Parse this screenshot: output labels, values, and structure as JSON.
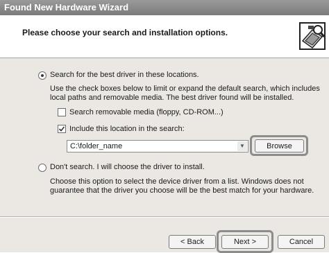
{
  "window": {
    "title": "Found New Hardware Wizard"
  },
  "header": {
    "title": "Please choose your search and installation options."
  },
  "options": {
    "search": {
      "label": "Search for the best driver in these locations.",
      "selected": true,
      "description": "Use the check boxes below to limit or expand the default search, which includes local paths and removable media. The best driver found will be installed.",
      "removable_media_label": "Search removable media (floppy, CD-ROM...)",
      "removable_media_checked": false,
      "include_location_label": "Include this location in the search:",
      "include_location_checked": true,
      "location_value": "C:\\folder_name",
      "browse_label": "Browse"
    },
    "dont_search": {
      "label": "Don't search. I will choose the driver to install.",
      "selected": false,
      "description": "Choose this option to select the device driver from a list.  Windows does not guarantee that the driver you choose will be the best match for your hardware."
    }
  },
  "footer": {
    "back_label": "< Back",
    "next_label": "Next >",
    "cancel_label": "Cancel"
  },
  "colors": {
    "title_bar": "#8a8a8a",
    "dialog_bg": "#ebe8e4",
    "highlight_outline": "#8c8c8c"
  }
}
